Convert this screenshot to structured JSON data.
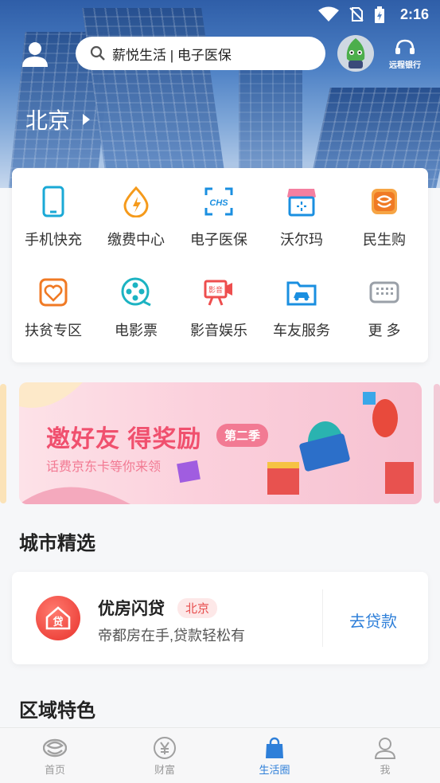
{
  "status_bar": {
    "time": "2:16"
  },
  "header": {
    "search_text": "薪悦生活 | 电子医保",
    "remote_bank_label": "远程银行",
    "city": "北京"
  },
  "services": [
    {
      "label": "手机快充",
      "icon": "phone-recharge-icon",
      "color": "#1aa9d6"
    },
    {
      "label": "缴费中心",
      "icon": "payment-center-icon",
      "color": "#f59a1b"
    },
    {
      "label": "电子医保",
      "icon": "chs-medical-icon",
      "color": "#1a8fe0",
      "icon_text": "CHS"
    },
    {
      "label": "沃尔玛",
      "icon": "walmart-store-icon",
      "color": "#1a8fe0"
    },
    {
      "label": "民生购",
      "icon": "minsheng-shop-icon",
      "color": "#f07a24"
    },
    {
      "label": "扶贫专区",
      "icon": "poverty-relief-icon",
      "color": "#f07a24"
    },
    {
      "label": "电影票",
      "icon": "film-reel-icon",
      "color": "#1cb3c2"
    },
    {
      "label": "影音娱乐",
      "icon": "video-camera-icon",
      "color": "#ee4e4e",
      "icon_text": "影音"
    },
    {
      "label": "车友服务",
      "icon": "car-folder-icon",
      "color": "#1a8fe0"
    },
    {
      "label": "更 多",
      "icon": "keyboard-more-icon",
      "color": "#9aa0a8"
    }
  ],
  "banner": {
    "title": "邀好友  得奖励",
    "season": "第二季",
    "subtitle": "话费京东卡等你来领"
  },
  "city_picks": {
    "title": "城市精选",
    "item": {
      "logo_text": "贷",
      "name": "优房闪贷",
      "tag": "北京",
      "desc": "帝都房在手,贷款轻松有",
      "cta": "去贷款"
    }
  },
  "regional": {
    "title": "区域特色"
  },
  "tabbar": [
    {
      "label": "首页",
      "icon": "minsheng-logo-icon",
      "active": false
    },
    {
      "label": "财富",
      "icon": "yuan-icon",
      "active": false
    },
    {
      "label": "生活圈",
      "icon": "shopping-bag-icon",
      "active": true
    },
    {
      "label": "我",
      "icon": "person-icon",
      "active": false
    }
  ],
  "colors": {
    "accent": "#2e7fd9",
    "banner_pink": "#f0506e",
    "loan_red": "#e8322c"
  }
}
